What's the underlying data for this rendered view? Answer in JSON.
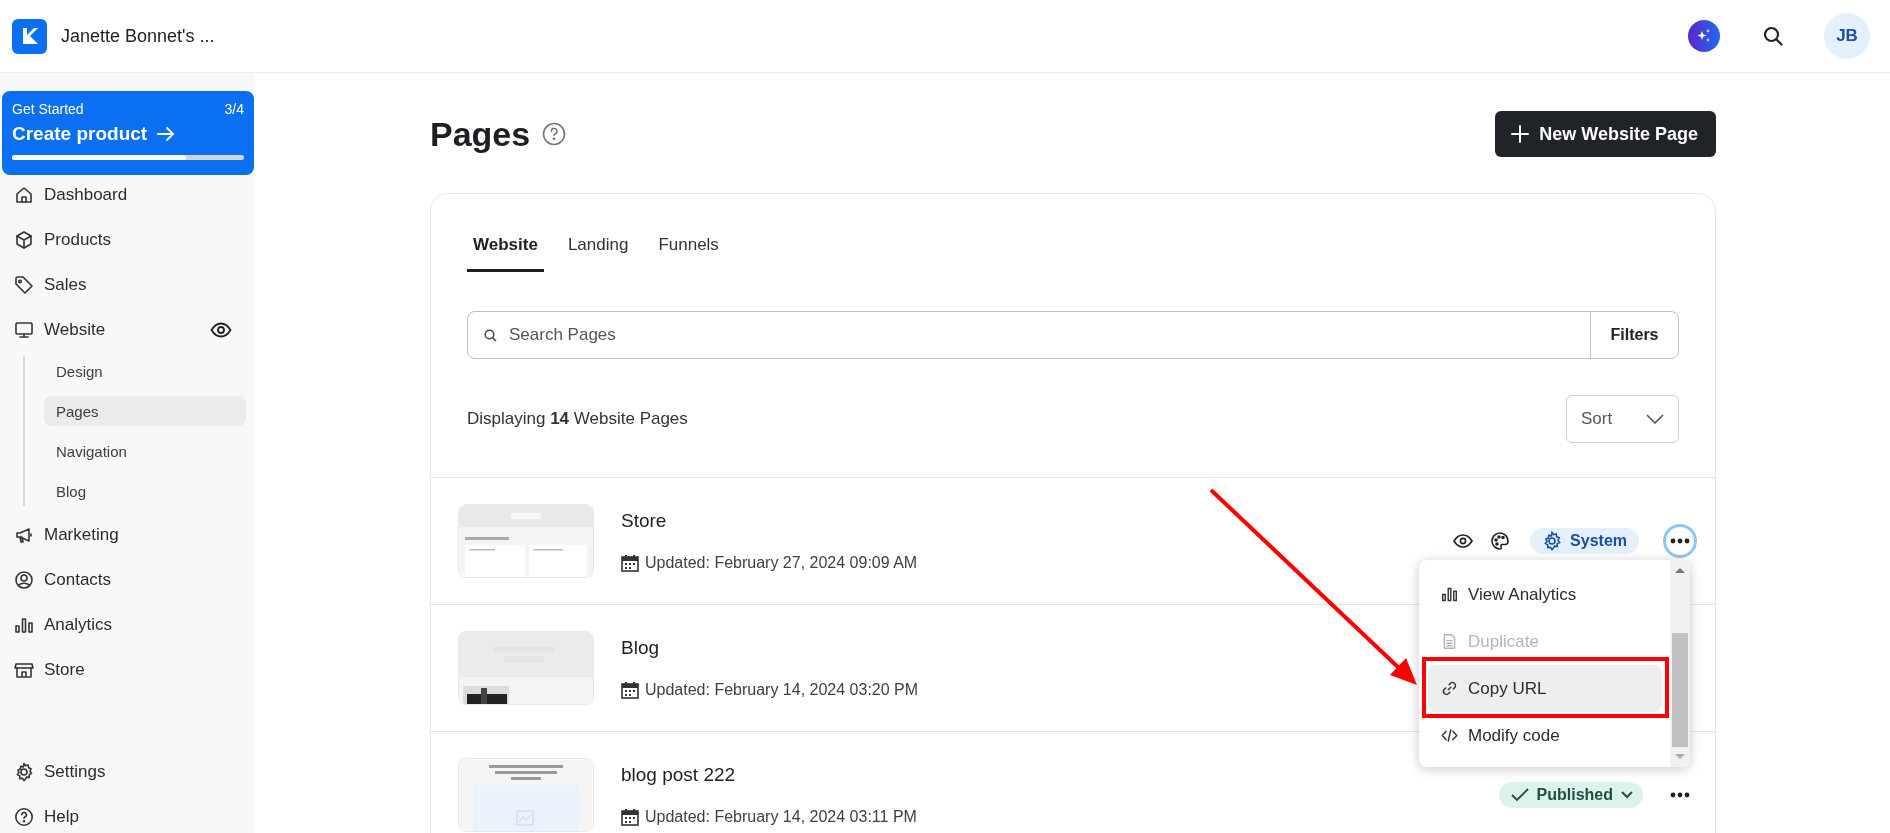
{
  "header": {
    "workspace": "Janette Bonnet's ...",
    "avatar": "JB"
  },
  "get_started": {
    "label": "Get Started",
    "progress": "3/4",
    "title": "Create product",
    "level": 0.75
  },
  "sidebar": {
    "items": [
      {
        "label": "Dashboard",
        "selected": false
      },
      {
        "label": "Products",
        "selected": false
      },
      {
        "label": "Sales",
        "selected": false
      },
      {
        "label": "Website",
        "selected": false,
        "expanded": true,
        "children": [
          {
            "label": "Design",
            "selected": false
          },
          {
            "label": "Pages",
            "selected": true
          },
          {
            "label": "Navigation",
            "selected": false
          },
          {
            "label": "Blog",
            "selected": false
          }
        ]
      },
      {
        "label": "Marketing",
        "selected": false
      },
      {
        "label": "Contacts",
        "selected": false
      },
      {
        "label": "Analytics",
        "selected": false
      },
      {
        "label": "Store",
        "selected": false
      }
    ],
    "footer": [
      {
        "label": "Settings",
        "selected": false
      },
      {
        "label": "Help",
        "selected": false
      }
    ]
  },
  "page": {
    "title": "Pages",
    "new_button": "New Website Page",
    "tabs": [
      {
        "label": "Website",
        "selected": true
      },
      {
        "label": "Landing",
        "selected": false
      },
      {
        "label": "Funnels",
        "selected": false
      }
    ],
    "search": {
      "placeholder": "Search Pages",
      "filters": "Filters"
    },
    "count": "Displaying **14** Website Pages",
    "sort": "Sort",
    "rows": [
      {
        "name": "Store",
        "updated": "Updated: February 27, 2024 09:09 AM",
        "preview_actions": true,
        "badge": {
          "kind": "system",
          "label": "System"
        },
        "more_button": true,
        "menu_open": true,
        "menu": {
          "items": [
            {
              "label": "View Analytics",
              "disabled": false,
              "hovered": false,
              "annotated": false
            },
            {
              "label": "Duplicate",
              "disabled": true,
              "hovered": false,
              "annotated": false
            },
            {
              "label": "Copy URL",
              "disabled": false,
              "hovered": true,
              "annotated": true
            },
            {
              "label": "Modify code",
              "disabled": false,
              "hovered": false,
              "annotated": false
            }
          ]
        }
      },
      {
        "name": "Blog",
        "updated": "Updated: February 14, 2024 03:20 PM",
        "preview_actions": false,
        "more_button": false,
        "menu_open": false
      },
      {
        "name": "blog post 222",
        "updated": "Updated: February 14, 2024 03:11 PM",
        "preview_actions": false,
        "badge": {
          "kind": "published",
          "label": "Published"
        },
        "more_button": true,
        "menu_open": false
      }
    ]
  }
}
